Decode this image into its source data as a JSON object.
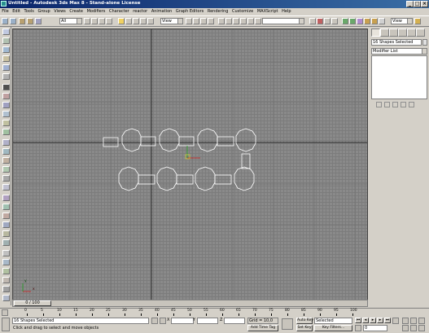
{
  "window": {
    "title": "Untitled - Autodesk 3ds Max 8 - Stand-alone License",
    "minimize_glyph": "_",
    "maximize_glyph": "□",
    "close_glyph": "×"
  },
  "menu": [
    "File",
    "Edit",
    "Tools",
    "Group",
    "Views",
    "Create",
    "Modifiers",
    "Character",
    "reactor",
    "Animation",
    "Graph Editors",
    "Rendering",
    "Customize",
    "MAXScript",
    "Help"
  ],
  "toolbar": {
    "selection_filter": "All",
    "reference_coord": "View",
    "named_selection": "",
    "viewport_dropdown": "View"
  },
  "command_panel": {
    "selection_name": "16 Shapes Selected",
    "modifier_list_label": "Modifier List"
  },
  "time_slider": {
    "label": "0 / 100",
    "current_frame": 0,
    "total_frames": 100
  },
  "trackbar": {
    "ticks": [
      "0",
      "5",
      "10",
      "15",
      "20",
      "25",
      "30",
      "35",
      "40",
      "45",
      "50",
      "55",
      "60",
      "65",
      "70",
      "75",
      "80",
      "85",
      "90",
      "95",
      "100"
    ]
  },
  "status": {
    "selection_count": "16 Shapes Selected",
    "prompt": "Click and drag to select and move objects",
    "x_label": "X",
    "x_value": "",
    "y_label": "Y",
    "y_value": "",
    "z_label": "Z",
    "z_value": "",
    "grid": "Grid = 10,0",
    "add_time_tag": "Add Time Tag",
    "auto_key": "Auto Key",
    "set_key": "Set Key",
    "key_mode": "Selected",
    "key_filters": "Key Filters...",
    "frame_value": "0"
  },
  "viewport": {
    "axis_x_label": "x",
    "axis_y_label": "y",
    "shape_color": "#ffffff",
    "background_color": "#8a8a8a",
    "grid_color": "#7c7c7c",
    "axis_line_color": "#2a2a2a"
  },
  "colors": {
    "title_gradient_start": "#0a246a",
    "title_gradient_end": "#3a6ea5",
    "ui_background": "#d4d0c8"
  }
}
